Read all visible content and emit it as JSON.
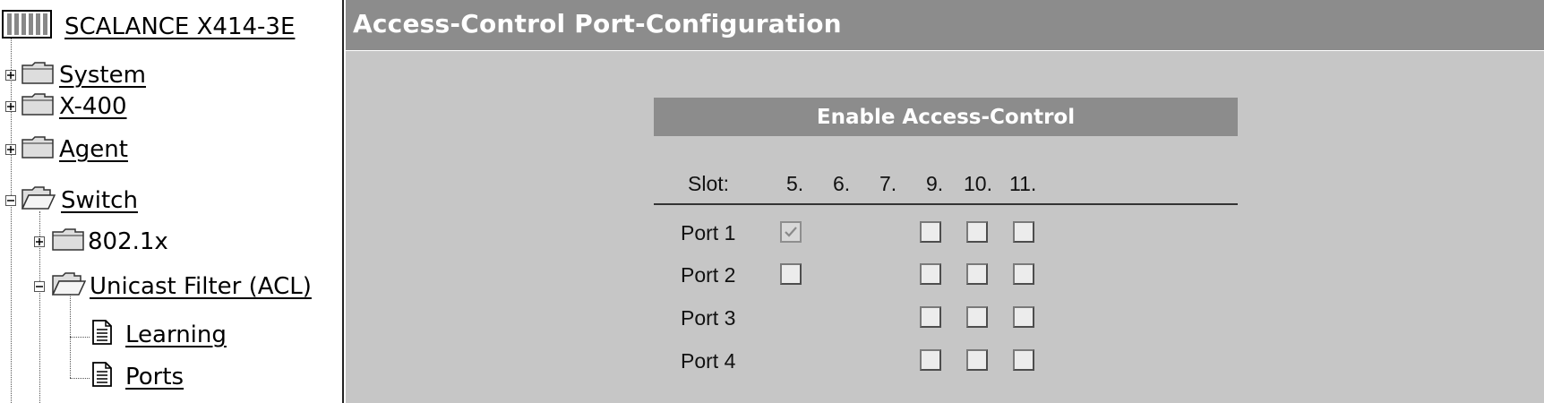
{
  "nav": {
    "device_label": "SCALANCE X414-3E",
    "items": [
      {
        "label": "System",
        "expander": "plus",
        "icon": "folder-closed-icon"
      },
      {
        "label": "X-400",
        "expander": "plus",
        "icon": "folder-closed-icon"
      },
      {
        "label": "Agent",
        "expander": "plus",
        "icon": "folder-closed-icon"
      },
      {
        "label": "Switch",
        "expander": "minus",
        "icon": "folder-open-icon"
      },
      {
        "label": "802.1x",
        "expander": "plus",
        "icon": "folder-closed-icon"
      },
      {
        "label": "Unicast Filter (ACL)",
        "expander": "minus",
        "icon": "folder-open-icon"
      },
      {
        "label": "Learning",
        "icon": "document-icon"
      },
      {
        "label": "Ports",
        "icon": "document-icon"
      }
    ]
  },
  "main": {
    "title": "Access-Control Port-Configuration",
    "panel_header": "Enable Access-Control",
    "slot_label": "Slot:",
    "slots": [
      "5.",
      "6.",
      "7.",
      "9.",
      "10.",
      "11."
    ],
    "rows": [
      {
        "label": "Port 1",
        "checkboxes": {
          "5.": "checked-disabled",
          "9.": "unchecked",
          "10.": "unchecked",
          "11.": "unchecked"
        }
      },
      {
        "label": "Port 2",
        "checkboxes": {
          "5.": "unchecked",
          "9.": "unchecked",
          "10.": "unchecked",
          "11.": "unchecked"
        }
      },
      {
        "label": "Port 3",
        "checkboxes": {
          "9.": "unchecked",
          "10.": "unchecked",
          "11.": "unchecked"
        }
      },
      {
        "label": "Port 4",
        "checkboxes": {
          "9.": "unchecked",
          "10.": "unchecked",
          "11.": "unchecked"
        }
      }
    ]
  },
  "colors": {
    "title_bar": "#8c8c8c",
    "content_bg": "#c6c6c6",
    "panel_header_bg": "#8c8c8c"
  }
}
